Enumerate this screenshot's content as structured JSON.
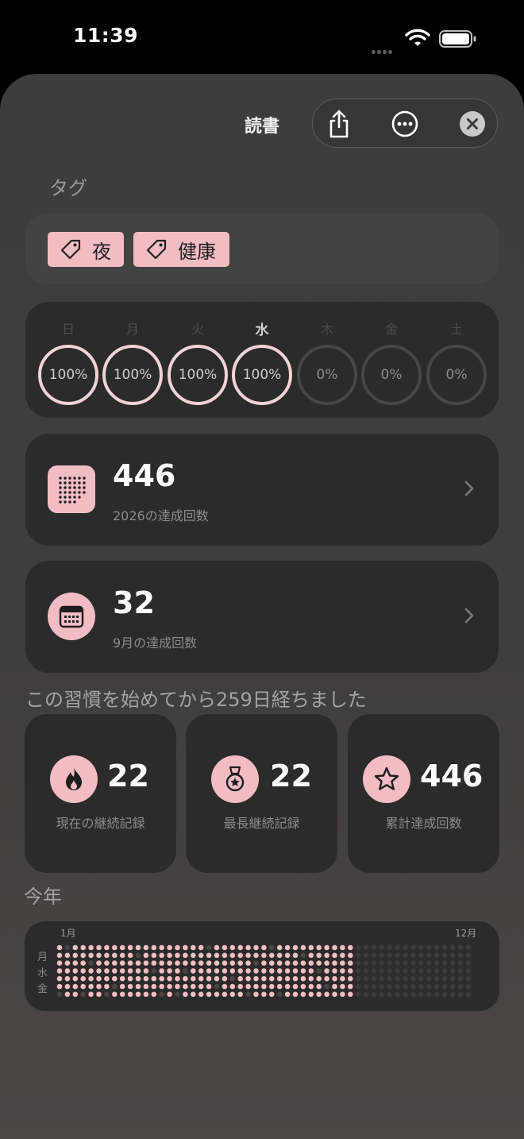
{
  "status_bar": {
    "time": "11:39"
  },
  "header": {
    "title": "読書"
  },
  "tags_section": {
    "label": "タグ",
    "tags": [
      "夜",
      "健康"
    ]
  },
  "week": {
    "days": [
      {
        "label": "日",
        "value": "100%",
        "done": true,
        "today": false
      },
      {
        "label": "月",
        "value": "100%",
        "done": true,
        "today": false
      },
      {
        "label": "火",
        "value": "100%",
        "done": true,
        "today": false
      },
      {
        "label": "水",
        "value": "100%",
        "done": true,
        "today": true
      },
      {
        "label": "木",
        "value": "0%",
        "done": false,
        "today": false
      },
      {
        "label": "金",
        "value": "0%",
        "done": false,
        "today": false
      },
      {
        "label": "土",
        "value": "0%",
        "done": false,
        "today": false
      }
    ]
  },
  "year_stat": {
    "value": "446",
    "label": "2026の達成回数"
  },
  "month_stat": {
    "value": "32",
    "label": "9月の達成回数"
  },
  "since_text": "この習慣を始めてから259日経ちました",
  "streaks": {
    "current": {
      "value": "22",
      "label": "現在の継続記録"
    },
    "longest": {
      "value": "22",
      "label": "最長継続記録"
    },
    "total": {
      "value": "446",
      "label": "累計達成回数"
    }
  },
  "this_year": {
    "label": "今年",
    "month_start": "1月",
    "month_end": "12月",
    "weekdays": [
      "月",
      "水",
      "金"
    ]
  },
  "colors": {
    "accent": "#f1bcc2",
    "dot_done": "#f1bcc2",
    "dot_missed": "#4a4444",
    "dot_future": "#3a3a3a"
  }
}
